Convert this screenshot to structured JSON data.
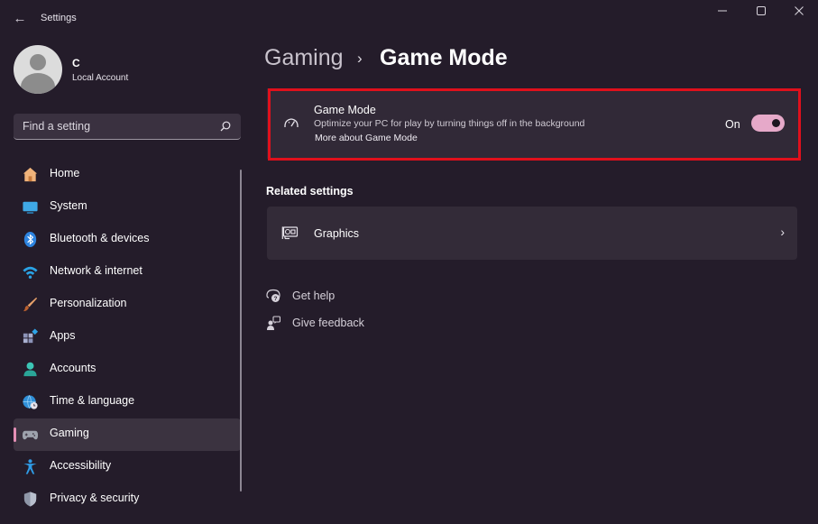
{
  "window": {
    "title": "Settings"
  },
  "account": {
    "name": "C",
    "type": "Local Account"
  },
  "search": {
    "placeholder": "Find a setting"
  },
  "nav": {
    "items": [
      {
        "label": "Home",
        "icon": "home-icon"
      },
      {
        "label": "System",
        "icon": "system-icon"
      },
      {
        "label": "Bluetooth & devices",
        "icon": "bluetooth-icon"
      },
      {
        "label": "Network & internet",
        "icon": "wifi-icon"
      },
      {
        "label": "Personalization",
        "icon": "brush-icon"
      },
      {
        "label": "Apps",
        "icon": "apps-icon"
      },
      {
        "label": "Accounts",
        "icon": "accounts-icon"
      },
      {
        "label": "Time & language",
        "icon": "globe-clock-icon"
      },
      {
        "label": "Gaming",
        "icon": "gamepad-icon",
        "active": true
      },
      {
        "label": "Accessibility",
        "icon": "accessibility-icon"
      },
      {
        "label": "Privacy & security",
        "icon": "shield-icon"
      }
    ]
  },
  "breadcrumb": {
    "parent": "Gaming",
    "separator": "›",
    "current": "Game Mode"
  },
  "game_mode": {
    "title": "Game Mode",
    "description": "Optimize your PC for play by turning things off in the background",
    "link": "More about Game Mode",
    "state_label": "On",
    "enabled": true
  },
  "related": {
    "heading": "Related settings",
    "items": [
      {
        "label": "Graphics",
        "icon": "graphics-card-icon"
      }
    ]
  },
  "help": {
    "get_help": "Get help",
    "give_feedback": "Give feedback"
  },
  "colors": {
    "background": "#241c2a",
    "card": "#312937",
    "accent": "#e6a9c9",
    "highlight_outline": "#e0101c"
  }
}
